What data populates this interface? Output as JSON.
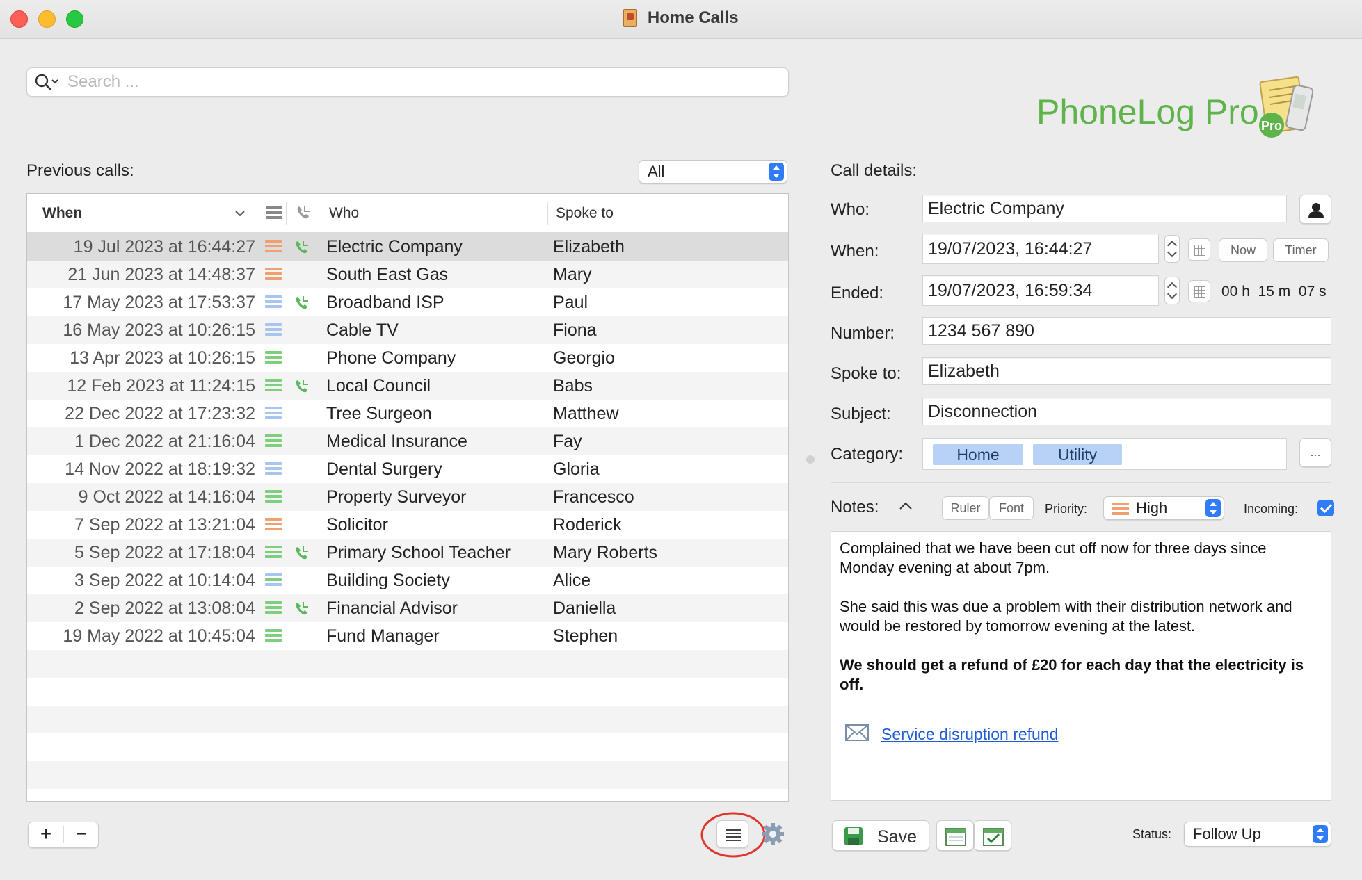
{
  "window": {
    "title": "Home Calls"
  },
  "search": {
    "placeholder": "Search ..."
  },
  "logo": {
    "text": "PhoneLog Pro",
    "badge": "Pro"
  },
  "calls_panel": {
    "label": "Previous calls:",
    "filter": "All",
    "columns": {
      "when": "When",
      "priority_icon": "priority-icon",
      "incoming_icon": "incoming-call-icon",
      "who": "Who",
      "spoke_to": "Spoke to"
    },
    "rows": [
      {
        "when": "19 Jul 2023 at 16:44:27",
        "priority": "high",
        "incoming": true,
        "who": "Electric Company",
        "spoke_to": "Elizabeth"
      },
      {
        "when": "21 Jun 2023 at 14:48:37",
        "priority": "high",
        "incoming": false,
        "who": "South East Gas",
        "spoke_to": "Mary"
      },
      {
        "when": "17 May 2023 at 17:53:37",
        "priority": "low",
        "incoming": true,
        "who": "Broadband ISP",
        "spoke_to": "Paul"
      },
      {
        "when": "16 May 2023 at 10:26:15",
        "priority": "low",
        "incoming": false,
        "who": "Cable TV",
        "spoke_to": "Fiona"
      },
      {
        "when": "13 Apr 2023 at 10:26:15",
        "priority": "normal",
        "incoming": false,
        "who": "Phone Company",
        "spoke_to": "Georgio"
      },
      {
        "when": "12 Feb 2023 at 11:24:15",
        "priority": "normal",
        "incoming": true,
        "who": "Local Council",
        "spoke_to": "Babs"
      },
      {
        "when": "22 Dec 2022 at 17:23:32",
        "priority": "low",
        "incoming": false,
        "who": "Tree Surgeon",
        "spoke_to": "Matthew"
      },
      {
        "when": "1 Dec 2022 at 21:16:04",
        "priority": "normal",
        "incoming": false,
        "who": "Medical Insurance",
        "spoke_to": "Fay"
      },
      {
        "when": "14 Nov 2022 at 18:19:32",
        "priority": "low",
        "incoming": false,
        "who": "Dental Surgery",
        "spoke_to": "Gloria"
      },
      {
        "when": "9 Oct 2022 at 14:16:04",
        "priority": "normal",
        "incoming": false,
        "who": "Property Surveyor",
        "spoke_to": "Francesco"
      },
      {
        "when": "7 Sep 2022 at 13:21:04",
        "priority": "high",
        "incoming": false,
        "who": "Solicitor",
        "spoke_to": "Roderick"
      },
      {
        "when": "5 Sep 2022 at 17:18:04",
        "priority": "normal",
        "incoming": true,
        "who": "Primary School Teacher",
        "spoke_to": "Mary Roberts"
      },
      {
        "when": "3 Sep 2022 at 10:14:04",
        "priority": "lownormal",
        "incoming": false,
        "who": "Building Society",
        "spoke_to": "Alice"
      },
      {
        "when": "2 Sep 2022 at 13:08:04",
        "priority": "normal",
        "incoming": true,
        "who": "Financial Advisor",
        "spoke_to": "Daniella"
      },
      {
        "when": "19 May 2022 at 10:45:04",
        "priority": "normal",
        "incoming": false,
        "who": "Fund Manager",
        "spoke_to": "Stephen"
      }
    ],
    "add_label": "+",
    "remove_label": "−"
  },
  "details": {
    "label": "Call details:",
    "who_label": "Who:",
    "who": "Electric Company",
    "when_label": "When:",
    "when": "19/07/2023, 16:44:27",
    "now_label": "Now",
    "timer_label": "Timer",
    "ended_label": "Ended:",
    "ended": "19/07/2023, 16:59:34",
    "duration": "00 h  15 m  07 s",
    "number_label": "Number:",
    "number": "1234 567 890",
    "spoke_to_label": "Spoke to:",
    "spoke_to": "Elizabeth",
    "subject_label": "Subject:",
    "subject": "Disconnection",
    "category_label": "Category:",
    "categories": [
      "Home",
      "Utility"
    ],
    "more_label": "..."
  },
  "notes": {
    "label": "Notes:",
    "ruler_label": "Ruler",
    "font_label": "Font",
    "priority_label": "Priority:",
    "priority": "High",
    "incoming_label": "Incoming:",
    "para1": "Complained that we have been cut off now for three days since Monday evening at about 7pm.",
    "para2": "She said this was due a problem with their distribution network and would be restored by tomorrow evening at the latest.",
    "para3": "We should get a refund of £20 for each day that the electricity is off.",
    "link": "Service disruption refund"
  },
  "footer": {
    "save_label": "Save",
    "status_label": "Status:",
    "status": "Follow Up"
  },
  "colors": {
    "high": "#f0a070",
    "normal": "#7dcf7d",
    "low": "#a8c4f0",
    "accent": "#2f7cf6",
    "brand": "#5eb34b"
  }
}
